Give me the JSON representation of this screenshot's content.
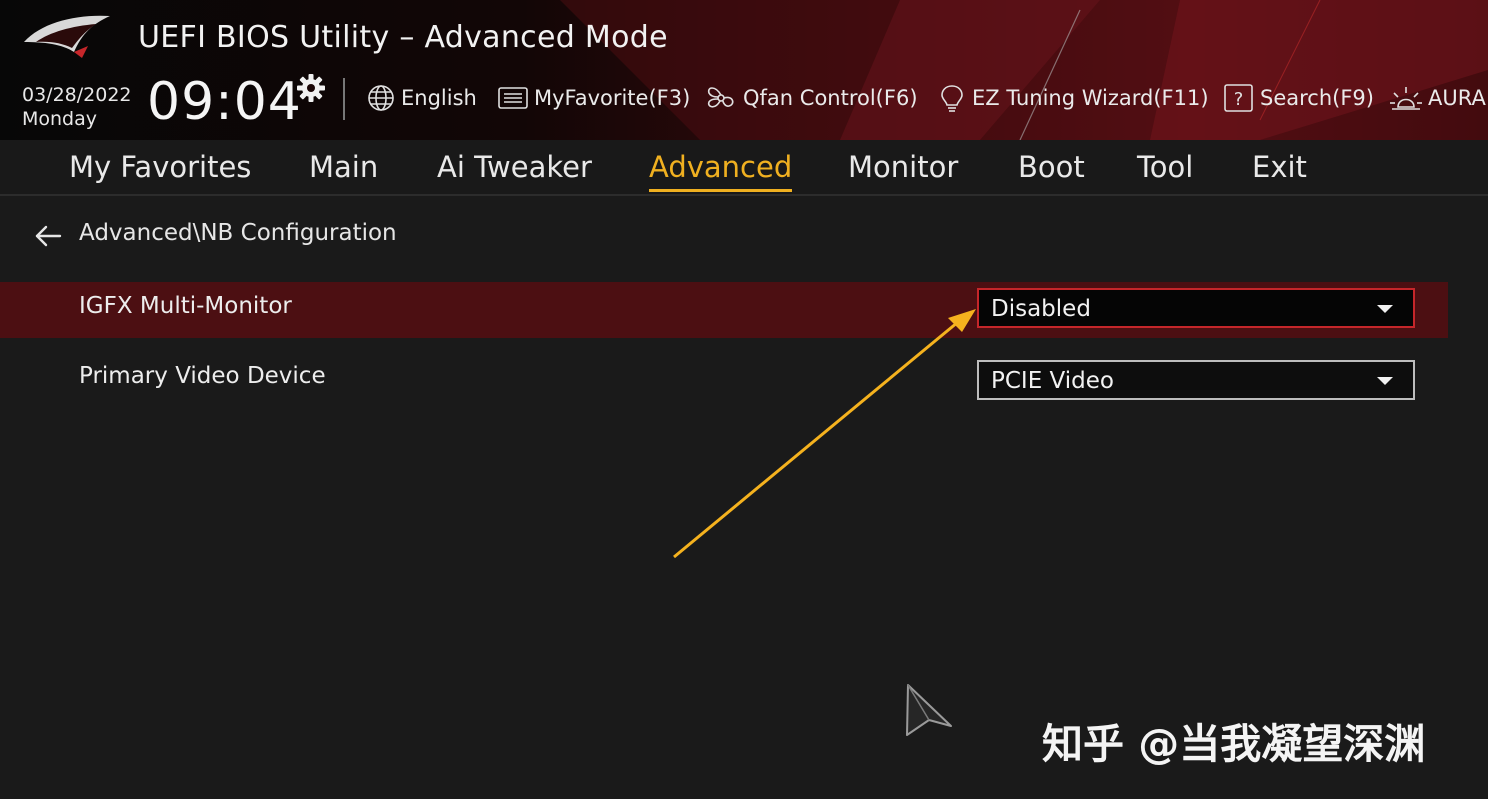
{
  "header": {
    "title": "UEFI BIOS Utility – Advanced Mode",
    "date": "03/28/2022",
    "day": "Monday",
    "time": "09:04",
    "tools": [
      {
        "icon": "globe-icon",
        "label": "English"
      },
      {
        "icon": "favorite-list-icon",
        "label": "MyFavorite(F3)"
      },
      {
        "icon": "fan-icon",
        "label": "Qfan Control(F6)"
      },
      {
        "icon": "lightbulb-icon",
        "label": "EZ Tuning Wizard(F11)"
      },
      {
        "icon": "question-icon",
        "label": "Search(F9)"
      },
      {
        "icon": "aura-light-icon",
        "label": "AURA"
      }
    ]
  },
  "menu": {
    "active": "Advanced",
    "items": [
      "My Favorites",
      "Main",
      "Ai Tweaker",
      "Advanced",
      "Monitor",
      "Boot",
      "Tool",
      "Exit"
    ]
  },
  "breadcrumb": "Advanced\\NB Configuration",
  "settings": [
    {
      "label": "IGFX Multi-Monitor",
      "value": "Disabled",
      "selected": true
    },
    {
      "label": "Primary Video Device",
      "value": "PCIE Video",
      "selected": false
    }
  ],
  "watermark": "知乎 @当我凝望深渊",
  "colors": {
    "accent": "#f0b020",
    "selected_row": "#4c0f12",
    "active_border": "#c5262a",
    "annotation_arrow": "#f5b21e"
  }
}
